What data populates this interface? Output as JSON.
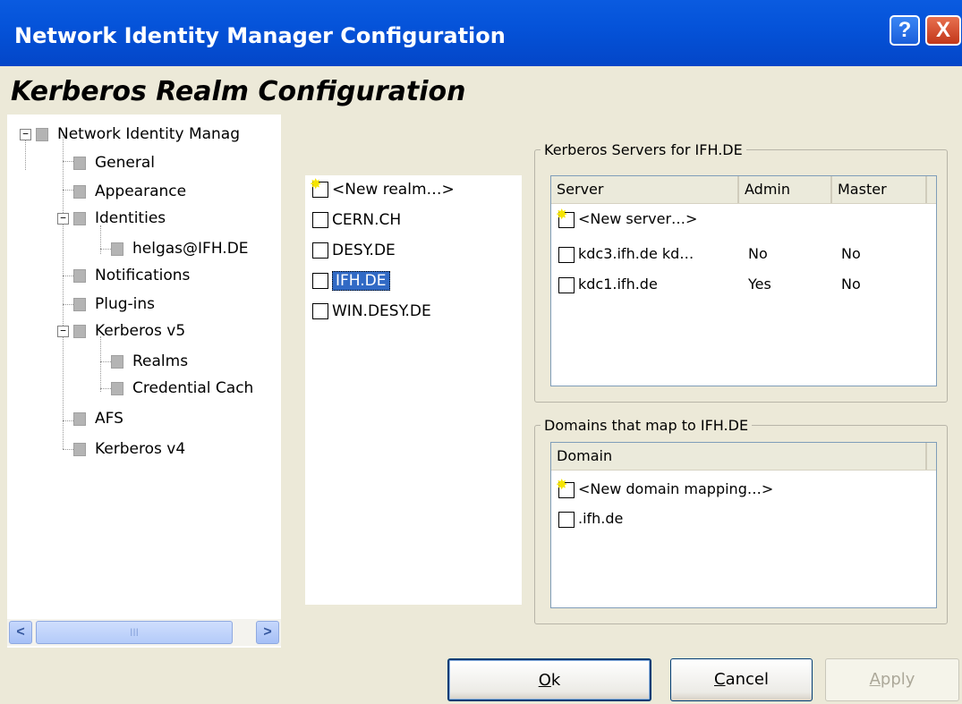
{
  "window": {
    "title": "Network Identity Manager Configuration",
    "help_icon": "?",
    "close_icon": "X"
  },
  "heading": "Kerberos Realm Configuration",
  "tree": {
    "items": [
      {
        "label": "Network Identity Manag"
      },
      {
        "label": "General"
      },
      {
        "label": "Appearance"
      },
      {
        "label": "Identities"
      },
      {
        "label": "helgas@IFH.DE"
      },
      {
        "label": "Notifications"
      },
      {
        "label": "Plug-ins"
      },
      {
        "label": "Kerberos v5"
      },
      {
        "label": "Realms"
      },
      {
        "label": "Credential Cach"
      },
      {
        "label": "AFS"
      },
      {
        "label": "Kerberos v4"
      }
    ],
    "expand_minus": "−",
    "scroll_left": "<",
    "scroll_right": ">",
    "scroll_grip": "III"
  },
  "realms": {
    "new_item": "<New realm…>",
    "items": [
      "CERN.CH",
      "DESY.DE",
      "IFH.DE",
      "WIN.DESY.DE"
    ],
    "selected": "IFH.DE"
  },
  "servers": {
    "group_label": "Kerberos Servers for IFH.DE",
    "columns": [
      "Server",
      "Admin",
      "Master"
    ],
    "new_item": "<New server…>",
    "rows": [
      {
        "server": "kdc3.ifh.de kd…",
        "admin": "No",
        "master": "No"
      },
      {
        "server": "kdc1.ifh.de",
        "admin": "Yes",
        "master": "No"
      }
    ]
  },
  "domains": {
    "group_label": "Domains that map to IFH.DE",
    "columns": [
      "Domain"
    ],
    "new_item": "<New domain mapping…>",
    "rows": [
      ".ifh.de"
    ]
  },
  "buttons": {
    "ok_accel": "O",
    "ok_rest": "k",
    "cancel_accel": "C",
    "cancel_rest": "ancel",
    "apply_accel": "A",
    "apply_rest": "pply"
  },
  "colors": {
    "titlebar": "#0553d9",
    "selection": "#316ac5",
    "dialog_bg": "#ece9d8"
  }
}
